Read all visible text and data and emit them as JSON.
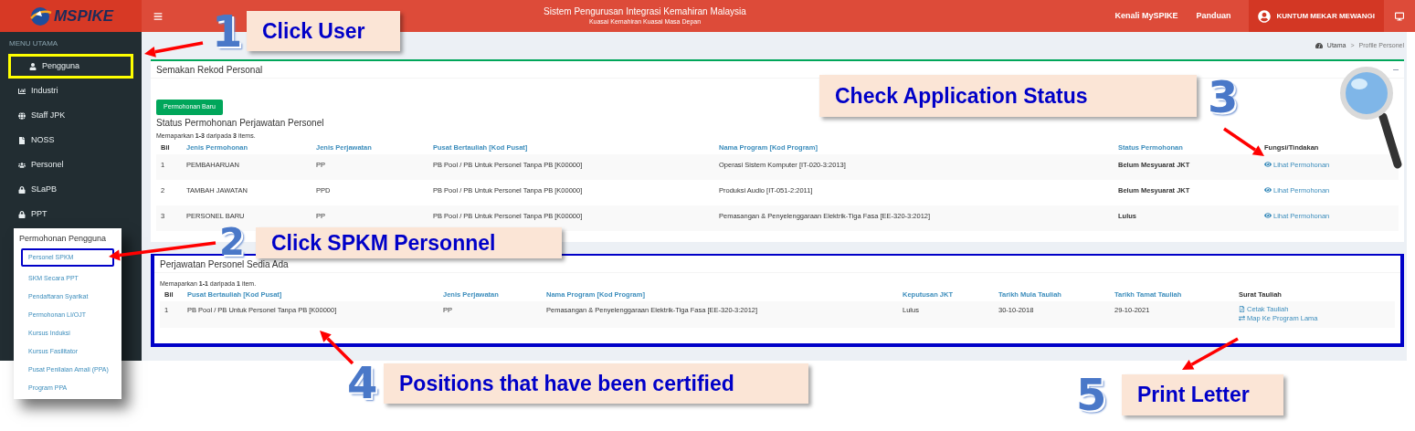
{
  "header": {
    "logo": "MSPIKE",
    "title": "Sistem Pengurusan Integrasi Kemahiran Malaysia",
    "subtitle": "Kuasai Kemahiran Kuasai Masa Depan",
    "links": [
      "Kenali MySPIKE",
      "Panduan"
    ],
    "user": "KUNTUM MEKAR MEWANGI"
  },
  "sidebar": {
    "heading": "MENU UTAMA",
    "items": [
      {
        "label": "Pengguna",
        "highlighted": true
      },
      {
        "label": "Industri",
        "highlighted": false
      },
      {
        "label": "Staff JPK",
        "highlighted": false
      },
      {
        "label": "NOSS",
        "highlighted": false
      },
      {
        "label": "Personel",
        "highlighted": false
      },
      {
        "label": "SLaPB",
        "highlighted": false
      },
      {
        "label": "PPT",
        "highlighted": false
      }
    ]
  },
  "submenu": {
    "title": "Permohonan Pengguna",
    "items": [
      {
        "label": "Personel SPKM",
        "highlighted": true
      },
      {
        "label": "SKM Secara PPT",
        "highlighted": false
      },
      {
        "label": "Pendaftaran Syarikat",
        "highlighted": false
      },
      {
        "label": "Permohonan LI/OJT",
        "highlighted": false
      },
      {
        "label": "Kursus Induksi",
        "highlighted": false
      },
      {
        "label": "Kursus Fasilitator",
        "highlighted": false
      },
      {
        "label": "Pusat Penilaian Amali (PPA)",
        "highlighted": false
      },
      {
        "label": "Program PPA",
        "highlighted": false
      }
    ]
  },
  "breadcrumb": {
    "items": [
      "Utama",
      "Profile Personel"
    ],
    "separator": ">"
  },
  "panel_1": {
    "title": "Semakan Rekod Personal",
    "button": "Permohonan Baru",
    "heading": "Status Permohonan Perjawatan Personel",
    "summary": "Memaparkan **1-3** daripada **3** items.",
    "highlighted": false,
    "columns": [
      "Bil",
      "Jenis Permohonan",
      "Jenis Perjawatan",
      "Pusat Bertauliah [Kod Pusat]",
      "Nama Program [Kod Program]",
      "Status Permohonan",
      "Fungsi/Tindakan"
    ],
    "rows": [
      {
        "cells": [
          "1",
          "PEMBAHARUAN",
          "PP",
          "PB Pool / PB Untuk Personel Tanpa PB [K00000]",
          "Operasi Sistem Komputer [IT-020-3:2013]",
          "Belum Mesyuarat JKT"
        ],
        "action": "Lihat Permohonan"
      },
      {
        "cells": [
          "2",
          "TAMBAH JAWATAN",
          "PPD",
          "PB Pool / PB Untuk Personel Tanpa PB [K00000]",
          "Produksi Audio [IT-051-2:2011]",
          "Belum Mesyuarat JKT"
        ],
        "action": "Lihat Permohonan"
      },
      {
        "cells": [
          "3",
          "PERSONEL BARU",
          "PP",
          "PB Pool / PB Untuk Personel Tanpa PB [K00000]",
          "Pemasangan & Penyelenggaraan Elektrik-Tiga Fasa [EE-320-3:2012]",
          "Lulus"
        ],
        "action": "Lihat Permohonan"
      }
    ]
  },
  "panel_2": {
    "title": "Perjawatan Personel Sedia Ada",
    "summary": "Memaparkan **1-1** daripada **1** item.",
    "highlighted": true,
    "columns": [
      "Bil",
      "Pusat Bertauliah [Kod Pusat]",
      "Jenis Perjawatan",
      "Nama Program [Kod Program]",
      "Keputusan JKT",
      "Tarikh Mula Tauliah",
      "Tarikh Tamat Tauliah",
      "Surat Tauliah"
    ],
    "rows": [
      {
        "cells": [
          "1",
          "PB Pool / PB Untuk Personel Tanpa PB [K00000]",
          "PP",
          "Pemasangan & Penyelenggaraan Elektrik-Tiga Fasa [EE-320-3:2012]",
          "Lulus",
          "30-10-2018",
          "29-10-2021"
        ],
        "actions": [
          "Cetak Tauliah",
          "Map Ke Program Lama"
        ]
      }
    ]
  },
  "callouts": [
    {
      "number": "1",
      "text": "Click User"
    },
    {
      "number": "2",
      "text": "Click SPKM Personnel"
    },
    {
      "number": "3",
      "text": "Check Application Status"
    },
    {
      "number": "4",
      "text": "Positions that have been certified"
    },
    {
      "number": "5",
      "text": "Print Letter"
    }
  ]
}
